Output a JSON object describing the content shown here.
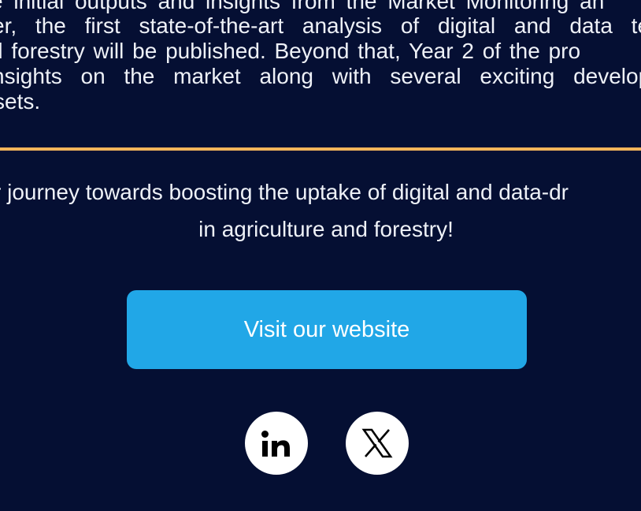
{
  "intro": {
    "lines": [
      "e initial outputs and insights from the Market Monitoring an",
      "er, the first state-of-the-art analysis of digital and data te",
      "d forestry will be published. Beyond that, Year 2 of the pro",
      "nsights on the market along with several exciting develop",
      "sets."
    ]
  },
  "cta": {
    "line1": "r journey towards boosting the uptake of digital and data-dr",
    "line2": "in agriculture and forestry!",
    "button_label": "Visit our website"
  },
  "social": {
    "linkedin_text": "in",
    "x_glyph": "𝕏"
  },
  "colors": {
    "background": "#050f33",
    "divider": "#f5b55a",
    "button": "#21a7e7",
    "text": "#eef1f7"
  },
  "icons": [
    "linkedin-icon",
    "x-icon"
  ]
}
